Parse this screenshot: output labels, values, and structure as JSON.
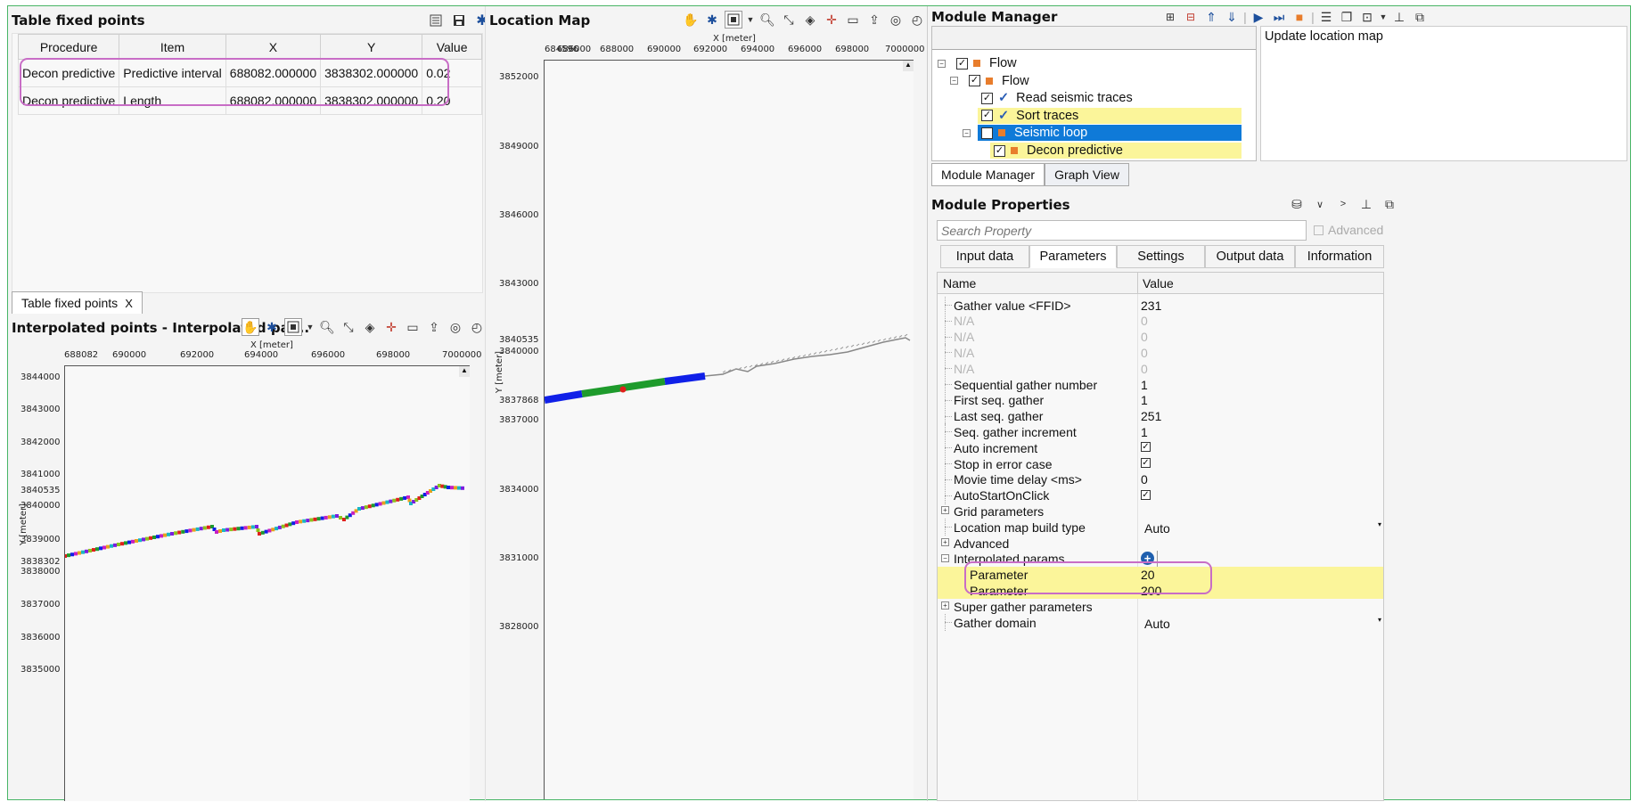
{
  "fixed_table": {
    "title": "Table fixed points",
    "columns": [
      "Procedure",
      "Item",
      "X",
      "Y",
      "Value"
    ],
    "rows": [
      [
        "Decon predictive",
        "Predictive interval",
        "688082.000000",
        "3838302.000000",
        "0.02"
      ],
      [
        "Decon predictive",
        "Length",
        "688082.000000",
        "3838302.000000",
        "0.20"
      ]
    ],
    "bottom_tab": "Table fixed points",
    "bottom_tab_close": "X"
  },
  "interp": {
    "title": "Interpolated points - Interpolated par...",
    "x_axis_label": "X [meter]",
    "y_axis_label": "Y [meter]",
    "x_ticks": [
      "688082",
      "690000",
      "692000",
      "694000",
      "696000",
      "698000",
      "7000000"
    ],
    "y_ticks": [
      "3844000",
      "3843000",
      "3842000",
      "3841000",
      "3840535",
      "3840000",
      "3839000",
      "3838302",
      "3838000",
      "3837000",
      "3836000",
      "3835000"
    ]
  },
  "location_map": {
    "title": "Location Map",
    "x_axis_label": "X [meter]",
    "y_axis_label": "Y [meter]",
    "x_ticks": [
      "684596",
      "686000",
      "688000",
      "690000",
      "692000",
      "694000",
      "696000",
      "698000",
      "7000000"
    ],
    "y_ticks": [
      "3852000",
      "3849000",
      "3846000",
      "3843000",
      "3840535",
      "3840000",
      "3837868",
      "3837000",
      "3834000",
      "3831000",
      "3828000"
    ],
    "colors": {
      "blue": "#1020e8",
      "green": "#1e9b2c",
      "red": "#e0201c",
      "trace": "#888888"
    }
  },
  "module_manager": {
    "title": "Module Manager",
    "description": "Update location map",
    "tree": [
      {
        "label": "Flow",
        "level": 0,
        "expander": "−",
        "checked": true,
        "mark": "square",
        "highlight": ""
      },
      {
        "label": "Flow",
        "level": 1,
        "expander": "−",
        "checked": true,
        "mark": "square",
        "highlight": ""
      },
      {
        "label": "Read seismic traces",
        "level": 2,
        "expander": "",
        "checked": true,
        "mark": "check",
        "highlight": ""
      },
      {
        "label": "Sort traces",
        "level": 2,
        "expander": "",
        "checked": true,
        "mark": "check",
        "highlight": "yellow"
      },
      {
        "label": "Seismic loop",
        "level": 2,
        "expander": "−",
        "checked": true,
        "mark": "square",
        "highlight": "blue"
      },
      {
        "label": "Decon predictive",
        "level": 3,
        "expander": "",
        "checked": true,
        "mark": "square",
        "highlight": "yellow"
      }
    ],
    "tabs": [
      "Module Manager",
      "Graph View"
    ]
  },
  "module_properties": {
    "title": "Module Properties",
    "search_placeholder": "Search Property",
    "advanced_label": "Advanced",
    "tabs": [
      "Input data",
      "Parameters",
      "Settings",
      "Output data",
      "Information"
    ],
    "active_tab": "Parameters",
    "col_name": "Name",
    "col_value": "Value",
    "rows": [
      {
        "name": "Gather value <FFID>",
        "value": "231",
        "type": "text",
        "expander": "",
        "disabled": false,
        "highlight": false,
        "indent": 0
      },
      {
        "name": "N/A",
        "value": "0",
        "type": "text",
        "expander": "",
        "disabled": true,
        "highlight": false,
        "indent": 0
      },
      {
        "name": "N/A",
        "value": "0",
        "type": "text",
        "expander": "",
        "disabled": true,
        "highlight": false,
        "indent": 0
      },
      {
        "name": "N/A",
        "value": "0",
        "type": "text",
        "expander": "",
        "disabled": true,
        "highlight": false,
        "indent": 0
      },
      {
        "name": "N/A",
        "value": "0",
        "type": "text",
        "expander": "",
        "disabled": true,
        "highlight": false,
        "indent": 0
      },
      {
        "name": "Sequential gather number",
        "value": "1",
        "type": "text",
        "expander": "",
        "disabled": false,
        "highlight": false,
        "indent": 0
      },
      {
        "name": "First seq. gather",
        "value": "1",
        "type": "text",
        "expander": "",
        "disabled": false,
        "highlight": false,
        "indent": 0
      },
      {
        "name": "Last seq. gather",
        "value": "251",
        "type": "text",
        "expander": "",
        "disabled": false,
        "highlight": false,
        "indent": 0
      },
      {
        "name": "Seq. gather increment",
        "value": "1",
        "type": "text",
        "expander": "",
        "disabled": false,
        "highlight": false,
        "indent": 0
      },
      {
        "name": "Auto increment",
        "value": "✓",
        "type": "check",
        "expander": "",
        "disabled": false,
        "highlight": false,
        "indent": 0
      },
      {
        "name": "Stop in error case",
        "value": "✓",
        "type": "check",
        "expander": "",
        "disabled": false,
        "highlight": false,
        "indent": 0
      },
      {
        "name": "Movie time delay <ms>",
        "value": "0",
        "type": "text",
        "expander": "",
        "disabled": false,
        "highlight": false,
        "indent": 0
      },
      {
        "name": "AutoStartOnClick",
        "value": "✓",
        "type": "check",
        "expander": "",
        "disabled": false,
        "highlight": false,
        "indent": 0
      },
      {
        "name": "Grid parameters",
        "value": "",
        "type": "group",
        "expander": "+",
        "disabled": false,
        "highlight": false,
        "indent": 0
      },
      {
        "name": "Location map build type",
        "value": "Auto",
        "type": "select",
        "expander": "",
        "disabled": false,
        "highlight": false,
        "indent": 0
      },
      {
        "name": "Advanced",
        "value": "",
        "type": "group",
        "expander": "+",
        "disabled": false,
        "highlight": false,
        "indent": 0
      },
      {
        "name": "Interpolated params",
        "value": "+",
        "type": "add",
        "expander": "−",
        "disabled": false,
        "highlight": false,
        "indent": 0
      },
      {
        "name": "Parameter",
        "value": "20",
        "type": "text",
        "expander": "",
        "disabled": false,
        "highlight": true,
        "indent": 1
      },
      {
        "name": "Parameter",
        "value": "200",
        "type": "text",
        "expander": "",
        "disabled": false,
        "highlight": true,
        "indent": 1
      },
      {
        "name": "Super gather parameters",
        "value": "",
        "type": "group",
        "expander": "+",
        "disabled": false,
        "highlight": false,
        "indent": 0
      },
      {
        "name": "Gather domain",
        "value": "Auto",
        "type": "select",
        "expander": "",
        "disabled": false,
        "highlight": false,
        "indent": 0
      }
    ]
  }
}
